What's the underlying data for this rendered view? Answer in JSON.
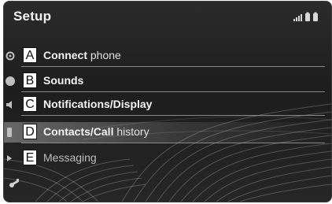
{
  "screen": {
    "title": "Setup"
  },
  "menu": {
    "items": [
      {
        "key": "A",
        "bold": "Connect",
        "rest": " phone"
      },
      {
        "key": "B",
        "bold": "Sounds",
        "rest": ""
      },
      {
        "key": "C",
        "bold": "Notifications/Display",
        "rest": ""
      },
      {
        "key": "D",
        "bold": "Contacts/Call",
        "rest": " history"
      },
      {
        "key": "E",
        "bold": "",
        "rest": "Messaging"
      }
    ]
  },
  "icons": {
    "status": "signal-battery-icons",
    "row_a": "gear-icon",
    "row_b": "bluetooth-icon",
    "row_c": "speaker-icon",
    "row_d": "phone-icon",
    "row_e": "message-arrow-icon",
    "bottom": "car-key-icon"
  },
  "colors": {
    "screen_bg": "#1d1d1d",
    "text": "#f4f4f4",
    "label_box_bg": "#ffffff",
    "separator": "#9a9a9a"
  }
}
